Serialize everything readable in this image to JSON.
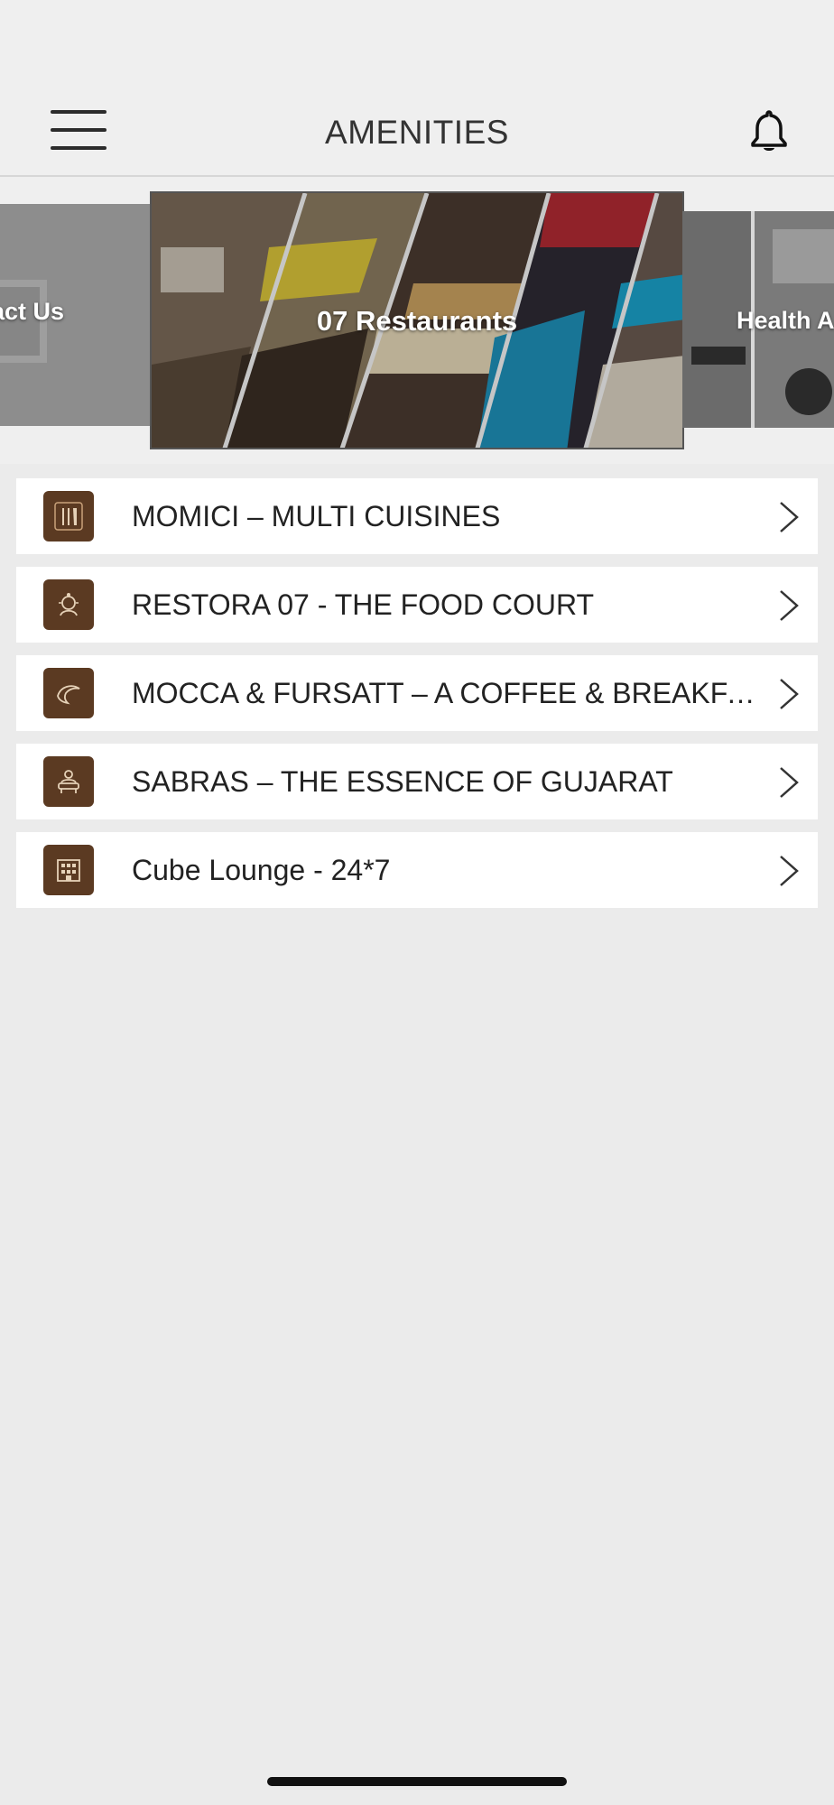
{
  "header": {
    "title": "AMENITIES",
    "menu_icon": "hamburger-menu-icon",
    "bell_icon": "bell-icon"
  },
  "carousel": {
    "cards": [
      {
        "label": "act Us"
      },
      {
        "label": "07 Restaurants"
      },
      {
        "label": "Health A"
      }
    ]
  },
  "list": {
    "items": [
      {
        "label": "MOMICI – MULTI CUISINES",
        "icon": "cutlery-icon"
      },
      {
        "label": "RESTORA 07 - THE FOOD COURT",
        "icon": "chef-icon"
      },
      {
        "label": "MOCCA & FURSATT – A COFFEE & BREAKFAST",
        "icon": "dolphin-icon"
      },
      {
        "label": "SABRAS – THE ESSENCE OF GUJARAT",
        "icon": "thali-icon"
      },
      {
        "label": "Cube Lounge - 24*7",
        "icon": "building-icon"
      }
    ]
  },
  "colors": {
    "icon_bg": "#5b3a22",
    "header_bg": "#efefef",
    "page_bg": "#ebebeb"
  }
}
